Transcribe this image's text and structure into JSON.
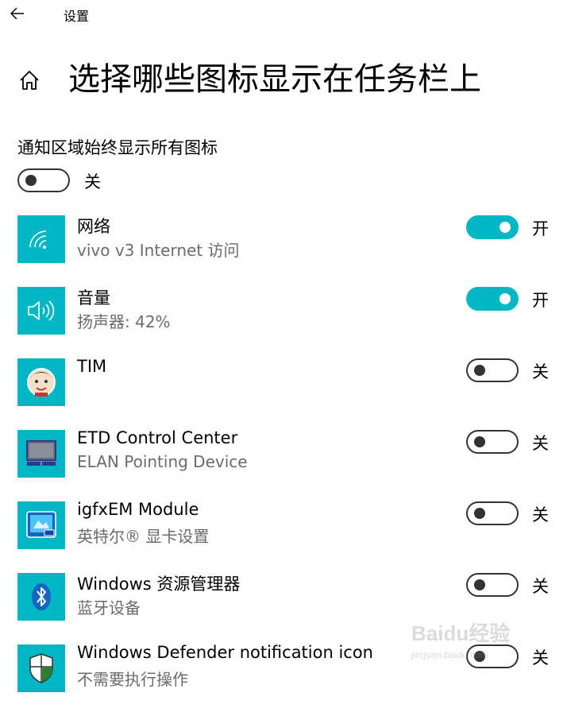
{
  "window": {
    "app_title": "设置"
  },
  "header": {
    "title": "选择哪些图标显示在任务栏上"
  },
  "master": {
    "label": "通知区域始终显示所有图标",
    "state": "关",
    "on": false
  },
  "rows": [
    {
      "name": "网络",
      "sub": "vivo v3 Internet 访问",
      "state": "开",
      "on": true,
      "icon": "wifi-icon"
    },
    {
      "name": "音量",
      "sub": "扬声器: 42%",
      "state": "开",
      "on": true,
      "icon": "speaker-icon"
    },
    {
      "name": "TIM",
      "sub": "",
      "state": "关",
      "on": false,
      "icon": "tim-avatar-icon"
    },
    {
      "name": "ETD Control Center",
      "sub": "ELAN Pointing Device",
      "state": "关",
      "on": false,
      "icon": "touchpad-icon"
    },
    {
      "name": "igfxEM Module",
      "sub": "英特尔® 显卡设置",
      "state": "关",
      "on": false,
      "icon": "intel-graphics-icon"
    },
    {
      "name": "Windows 资源管理器",
      "sub": "蓝牙设备",
      "state": "关",
      "on": false,
      "icon": "bluetooth-icon"
    },
    {
      "name": "Windows Defender notification icon",
      "sub": "不需要执行操作",
      "state": "关",
      "on": false,
      "icon": "defender-shield-icon"
    }
  ],
  "colors": {
    "accent": "#00b7c3",
    "toggle_off_border": "#333333",
    "subtext": "#6b6b6b"
  },
  "watermark": {
    "text": "Baidu经验",
    "sub": "jingyan.baidu.com"
  }
}
